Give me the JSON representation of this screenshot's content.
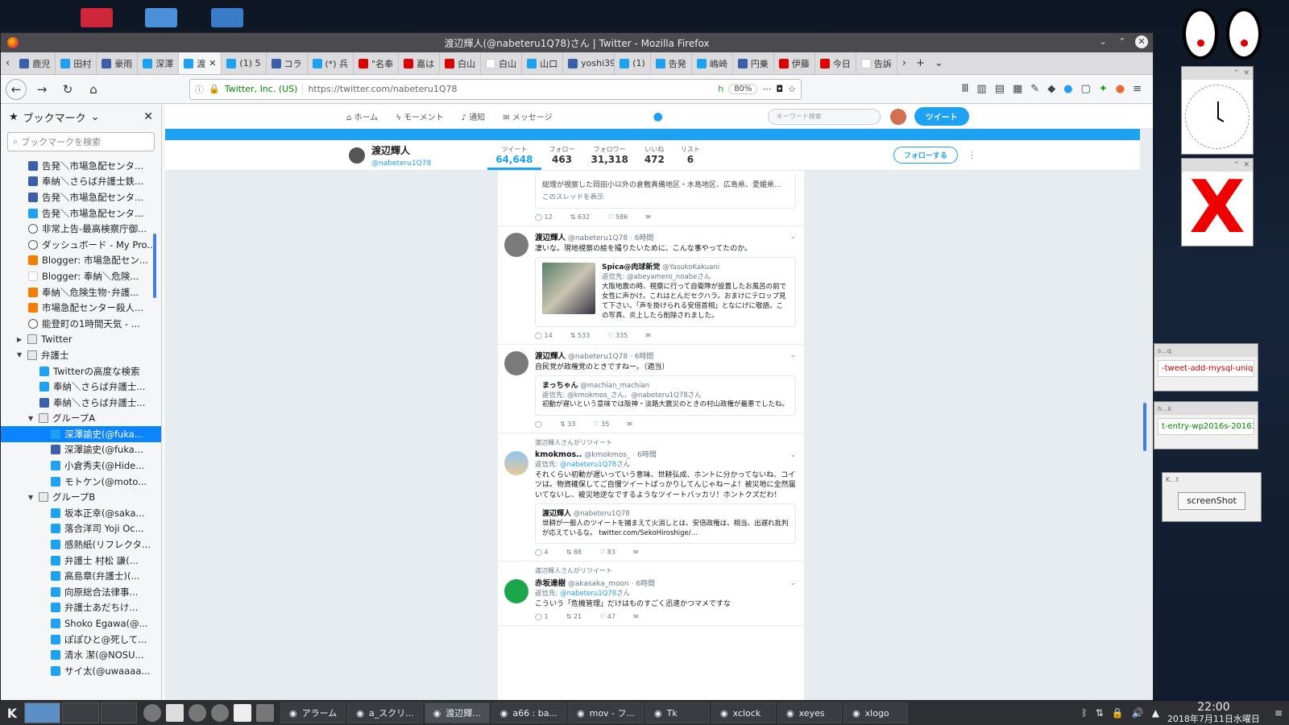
{
  "window": {
    "title": "渡辺輝人(@nabeteru1Q78)さん | Twitter - Mozilla Firefox"
  },
  "tabs": [
    {
      "label": "鹿児"
    },
    {
      "label": "田村"
    },
    {
      "label": "豪雨"
    },
    {
      "label": "深澤"
    },
    {
      "label": "渡",
      "active": true
    },
    {
      "label": "(1) 5"
    },
    {
      "label": "コラ"
    },
    {
      "label": "(*) 兵"
    },
    {
      "label": "\"名奉"
    },
    {
      "label": "嘉は"
    },
    {
      "label": "白山"
    },
    {
      "label": "白山"
    },
    {
      "label": "山口"
    },
    {
      "label": "yoshi39"
    },
    {
      "label": "(1)"
    },
    {
      "label": "告発"
    },
    {
      "label": "嶋崎"
    },
    {
      "label": "円乗"
    },
    {
      "label": "伊藤"
    },
    {
      "label": "今日"
    },
    {
      "label": "告訴"
    }
  ],
  "urlbar": {
    "org": "Twitter, Inc. (US)",
    "url": "https://twitter.com/nabeteru1Q78",
    "zoom": "80%"
  },
  "sidebar": {
    "title": "ブックマーク",
    "search_placeholder": "ブックマークを検索",
    "items": [
      {
        "label": "告発＼市場急配センタ...",
        "icon": "b",
        "indent": 3
      },
      {
        "label": "奉納＼さらば弁護士鉄...",
        "icon": "b",
        "indent": 3
      },
      {
        "label": "告発＼市場急配センタ...",
        "icon": "b",
        "indent": 3
      },
      {
        "label": "告発＼市場急配センタ...",
        "icon": "tw",
        "indent": 3
      },
      {
        "label": "非常上告-最高検察庁御...",
        "icon": "globe",
        "indent": 3
      },
      {
        "label": "ダッシュボード - My Pro...",
        "icon": "globe",
        "indent": 3
      },
      {
        "label": "Blogger: 市場急配セン...",
        "icon": "blog",
        "indent": 3
      },
      {
        "label": "Blogger: 奉納＼危険...",
        "icon": "g",
        "indent": 3
      },
      {
        "label": "奉納＼危険生物･弁護...",
        "icon": "blog",
        "indent": 3
      },
      {
        "label": "市場急配センター殺人...",
        "icon": "blog",
        "indent": 3
      },
      {
        "label": "能登町の1時間天気 - ...",
        "icon": "globe",
        "indent": 3
      },
      {
        "label": "Twitter",
        "icon": "folder",
        "indent": 2,
        "arrow": "▶"
      },
      {
        "label": "弁護士",
        "icon": "folder",
        "indent": 2,
        "arrow": "▼"
      },
      {
        "label": "Twitterの高度な検索",
        "icon": "tw",
        "indent": 4
      },
      {
        "label": "奉納＼さらば弁護士...",
        "icon": "tw",
        "indent": 4
      },
      {
        "label": "奉納＼さらば弁護士...",
        "icon": "b",
        "indent": 4
      },
      {
        "label": "グループA",
        "icon": "folder",
        "indent": 3,
        "arrow": "▼"
      },
      {
        "label": "深澤諭史(@fuka...",
        "icon": "tw",
        "indent": 5,
        "selected": true
      },
      {
        "label": "深澤諭史(@fuka...",
        "icon": "b",
        "indent": 5
      },
      {
        "label": "小倉秀夫(@Hide...",
        "icon": "tw",
        "indent": 5
      },
      {
        "label": "モトケン(@moto...",
        "icon": "tw",
        "indent": 5
      },
      {
        "label": "グループB",
        "icon": "folder",
        "indent": 3,
        "arrow": "▼"
      },
      {
        "label": "坂本正幸(@saka...",
        "icon": "tw",
        "indent": 5
      },
      {
        "label": "落合洋司 Yoji Oc...",
        "icon": "tw",
        "indent": 5
      },
      {
        "label": "感熱紙(リフレクタ...",
        "icon": "tw",
        "indent": 5
      },
      {
        "label": "弁護士 村松 謙(...",
        "icon": "tw",
        "indent": 5
      },
      {
        "label": "高島章(弁護士)(...",
        "icon": "tw",
        "indent": 5
      },
      {
        "label": "向原総合法律事...",
        "icon": "tw",
        "indent": 5
      },
      {
        "label": "弁護士あだちけ...",
        "icon": "tw",
        "indent": 5
      },
      {
        "label": "Shoko Egawa(@...",
        "icon": "tw",
        "indent": 5
      },
      {
        "label": "ぽぽひと@死して...",
        "icon": "tw",
        "indent": 5
      },
      {
        "label": "清水 潔(@NOSU...",
        "icon": "tw",
        "indent": 5
      },
      {
        "label": "サイ太(@uwaaaa...",
        "icon": "tw",
        "indent": 5
      }
    ]
  },
  "twitter_nav": {
    "home": "ホーム",
    "moments": "モーメント",
    "notifications": "通知",
    "messages": "メッセージ",
    "search_placeholder": "キーワード検索",
    "tweet_button": "ツイート"
  },
  "profile": {
    "name": "渡辺輝人",
    "handle": "@nabeteru1Q78",
    "stats": [
      {
        "label": "ツイート",
        "value": "64,648",
        "active": true
      },
      {
        "label": "フォロー",
        "value": "463"
      },
      {
        "label": "フォロワー",
        "value": "31,318"
      },
      {
        "label": "いいね",
        "value": "472"
      },
      {
        "label": "リスト",
        "value": "6"
      }
    ],
    "follow_button": "フォローする"
  },
  "tweets": {
    "t0": {
      "text1": "総理が視察した岡田小以外の倉敷真備地区・水島地区、広島県、愛媛県...",
      "show_thread": "このスレッドを表示",
      "replies": "12",
      "retweets": "632",
      "likes": "586"
    },
    "t1": {
      "name": "渡辺輝人",
      "handle": "@nabeteru1Q78",
      "time": "· 6時間",
      "text": "凄いな。現地視察の絵を撮りたいために、こんな事やってたのか。",
      "quote_name": "Spica@肉球新党",
      "quote_handle": "@YasukoKakuani",
      "quote_reply": "返信先: @abeyamero_noabeさん",
      "quote_text": "大阪地震の時、視察に行って自衛隊が設置したお風呂の前で女性に声かけ。これはとんだセクハラ。おまけにテロップ見て下さい。「声を掛けられる安倍首相」となにげに敬語。この写真、炎上したら削除されました。",
      "replies": "14",
      "retweets": "533",
      "likes": "335"
    },
    "t2": {
      "name": "渡辺輝人",
      "handle": "@nabeteru1Q78",
      "time": "· 6時間",
      "text": "自民党が政権党のときですねー。（適当）",
      "quote_name": "まっちゃん",
      "quote_handle": "@machian_machian",
      "quote_reply": "返信先: @kmokmos_さん、@nabeteru1Q78さん",
      "quote_text": "初動が遅いという意味では阪神・淡路大震災のときの村山政権が最悪でしたね。",
      "replies": "",
      "retweets": "33",
      "likes": "35"
    },
    "t3": {
      "rt_label": "渡辺輝人さんがリツイート",
      "name": "kmokmos..",
      "handle": "@kmokmos_",
      "time": "· 6時間",
      "reply_prefix": "返信先: ",
      "reply_to": "@nabeteru1Q78",
      "reply_suffix": "さん",
      "text": "それくらい初動が遅いっていう意味、世耕弘成、ホントに分かってないね、コイツは。物資確保してご自慢ツイートばっかりしてんじゃねーよ！被災地に全然届いてないし、被災地逆なでするようなツイートバッカリ！ホントクズだわ！",
      "quote_name": "渡辺輝人",
      "quote_handle": "@nabeteru1Q78",
      "quote_text": "世耕が一般人のツイートを捕まえて火消しとは、安倍政権は、相当、出遅れ批判が応えているな。 twitter.com/SekoHiroshige/...",
      "replies": "4",
      "retweets": "88",
      "likes": "83"
    },
    "t4": {
      "rt_label": "渡辺輝人さんがリツイート",
      "name": "赤坂達樹",
      "handle": "@akasaka_moon",
      "time": "· 6時間",
      "reply_prefix": "返信先: ",
      "reply_to": "@nabeteru1Q78",
      "reply_suffix": "さん",
      "text": "こういう「危機管理」だけはものすごく迅速かつマメですな",
      "replies": "1",
      "retweets": "21",
      "likes": "47"
    }
  },
  "desktop": {
    "term1": "-tweet-add-mysql-uniq.r",
    "term2": "t-entry-wp2016s-20161",
    "shot_button": "screenShot",
    "term1_title": "s...q",
    "term2_title": "h...k",
    "shot_title": "K...t"
  },
  "taskbar": {
    "tasks": [
      {
        "label": "アラーム"
      },
      {
        "label": "a_スクリ..."
      },
      {
        "label": "渡辺輝...",
        "active": true
      },
      {
        "label": "a66 : ba..."
      },
      {
        "label": "mov - フ..."
      },
      {
        "label": "Tk"
      },
      {
        "label": "xclock"
      },
      {
        "label": "xeyes"
      },
      {
        "label": "xlogo"
      }
    ],
    "time": "22:00",
    "date": "2018年7月11日水曜日"
  }
}
